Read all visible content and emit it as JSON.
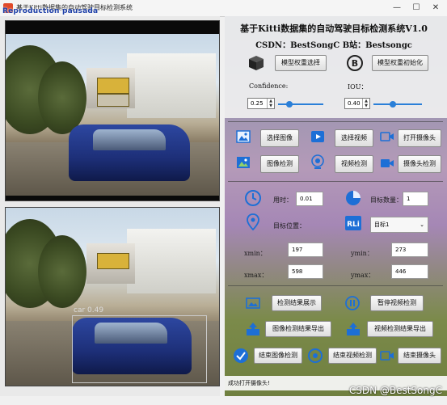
{
  "window": {
    "title": "基于Kitti数据集的自动驾驶目标检测系统",
    "watermark": "Reproduction pausada",
    "min": "—",
    "max": "☐",
    "close": "✕"
  },
  "left": {
    "detection": {
      "label": "car  0.49"
    }
  },
  "right": {
    "heading": "基于Kitti数据集的自动驾驶目标检测系统V1.0",
    "csdn": "CSDN：BestSongC      B站：Bestsongc",
    "btn_select_weights": "模型权重选择",
    "btn_init_weights": "模型权重初始化",
    "confidence_label": "Confidence:",
    "iou_label": "IOU：",
    "confidence_value": "0.25",
    "iou_value": "0.40",
    "confidence_fraction": 0.25,
    "iou_fraction": 0.4,
    "btn_select_image": "选择图像",
    "btn_select_video": "选择视频",
    "btn_open_camera": "打开摄像头",
    "btn_image_detect": "图像检测",
    "btn_video_detect": "视频检测",
    "btn_camera_detect": "摄像头检测",
    "time_label": "用时：",
    "time_value": "0.01",
    "count_label": "目标数量：",
    "count_value": "1",
    "position_label": "目标位置：",
    "target_select": "目标1",
    "xmin_label": "xmin：",
    "xmin_value": "197",
    "ymin_label": "ymin：",
    "ymin_value": "273",
    "xmax_label": "xmax：",
    "xmax_value": "598",
    "ymax_label": "ymax：",
    "ymax_value": "446",
    "btn_show_result": "检测结果展示",
    "btn_pause_video": "暂停视频检测",
    "btn_export_image": "图像检测结果导出",
    "btn_export_video": "视频检测结果导出",
    "btn_end_image": "结束图像检测",
    "btn_end_video": "结束视频检测",
    "btn_end_camera": "结束摄像头",
    "status": "成功打开摄像头!",
    "csdn_watermark": "CSDN @BestSongC"
  },
  "icons": {
    "cube": "cube-icon",
    "b": "b-logo-icon",
    "image": "image-icon",
    "play": "play-icon",
    "camera": "camera-icon",
    "gallery": "gallery-icon",
    "webcam": "webcam-icon",
    "clock": "clock-icon",
    "pie": "pie-icon",
    "pin": "pin-icon",
    "target": "target-icon",
    "export": "export-icon",
    "check": "check-icon",
    "stop": "stop-icon"
  }
}
